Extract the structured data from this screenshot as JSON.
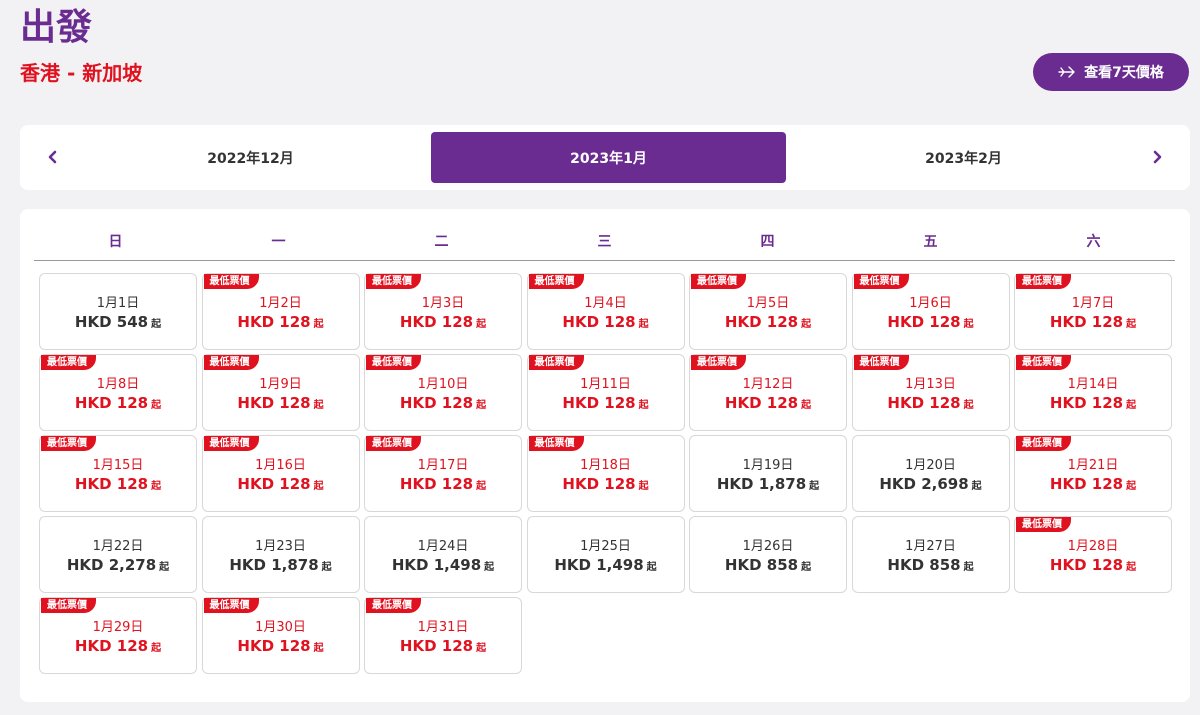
{
  "header": {
    "title": "出發",
    "route": "香港 - 新加坡",
    "week_button_label": "查看7天價格"
  },
  "month_nav": {
    "prev_month": "2022年12月",
    "current_month": "2023年1月",
    "next_month": "2023年2月"
  },
  "weekdays": [
    "日",
    "一",
    "二",
    "三",
    "四",
    "五",
    "六"
  ],
  "calendar": {
    "lowest_badge": "最低票價",
    "price_suffix": "起",
    "start_weekday": 0,
    "days": [
      {
        "date": "1月1日",
        "price": "HKD 548",
        "cheapest": false
      },
      {
        "date": "1月2日",
        "price": "HKD 128",
        "cheapest": true
      },
      {
        "date": "1月3日",
        "price": "HKD 128",
        "cheapest": true
      },
      {
        "date": "1月4日",
        "price": "HKD 128",
        "cheapest": true
      },
      {
        "date": "1月5日",
        "price": "HKD 128",
        "cheapest": true
      },
      {
        "date": "1月6日",
        "price": "HKD 128",
        "cheapest": true
      },
      {
        "date": "1月7日",
        "price": "HKD 128",
        "cheapest": true
      },
      {
        "date": "1月8日",
        "price": "HKD 128",
        "cheapest": true
      },
      {
        "date": "1月9日",
        "price": "HKD 128",
        "cheapest": true
      },
      {
        "date": "1月10日",
        "price": "HKD 128",
        "cheapest": true
      },
      {
        "date": "1月11日",
        "price": "HKD 128",
        "cheapest": true
      },
      {
        "date": "1月12日",
        "price": "HKD 128",
        "cheapest": true
      },
      {
        "date": "1月13日",
        "price": "HKD 128",
        "cheapest": true
      },
      {
        "date": "1月14日",
        "price": "HKD 128",
        "cheapest": true
      },
      {
        "date": "1月15日",
        "price": "HKD 128",
        "cheapest": true
      },
      {
        "date": "1月16日",
        "price": "HKD 128",
        "cheapest": true
      },
      {
        "date": "1月17日",
        "price": "HKD 128",
        "cheapest": true
      },
      {
        "date": "1月18日",
        "price": "HKD 128",
        "cheapest": true
      },
      {
        "date": "1月19日",
        "price": "HKD 1,878",
        "cheapest": false
      },
      {
        "date": "1月20日",
        "price": "HKD 2,698",
        "cheapest": false
      },
      {
        "date": "1月21日",
        "price": "HKD 128",
        "cheapest": true
      },
      {
        "date": "1月22日",
        "price": "HKD 2,278",
        "cheapest": false
      },
      {
        "date": "1月23日",
        "price": "HKD 1,878",
        "cheapest": false
      },
      {
        "date": "1月24日",
        "price": "HKD 1,498",
        "cheapest": false
      },
      {
        "date": "1月25日",
        "price": "HKD 1,498",
        "cheapest": false
      },
      {
        "date": "1月26日",
        "price": "HKD 858",
        "cheapest": false
      },
      {
        "date": "1月27日",
        "price": "HKD 858",
        "cheapest": false
      },
      {
        "date": "1月28日",
        "price": "HKD 128",
        "cheapest": true
      },
      {
        "date": "1月29日",
        "price": "HKD 128",
        "cheapest": true
      },
      {
        "date": "1月30日",
        "price": "HKD 128",
        "cheapest": true
      },
      {
        "date": "1月31日",
        "price": "HKD 128",
        "cheapest": true
      }
    ]
  },
  "colors": {
    "brand_purple": "#6a2c91",
    "accent_red": "#e0121f"
  },
  "icons": {
    "week_button": "plane-icon",
    "prev": "chevron-left-icon",
    "next": "chevron-right-icon"
  }
}
